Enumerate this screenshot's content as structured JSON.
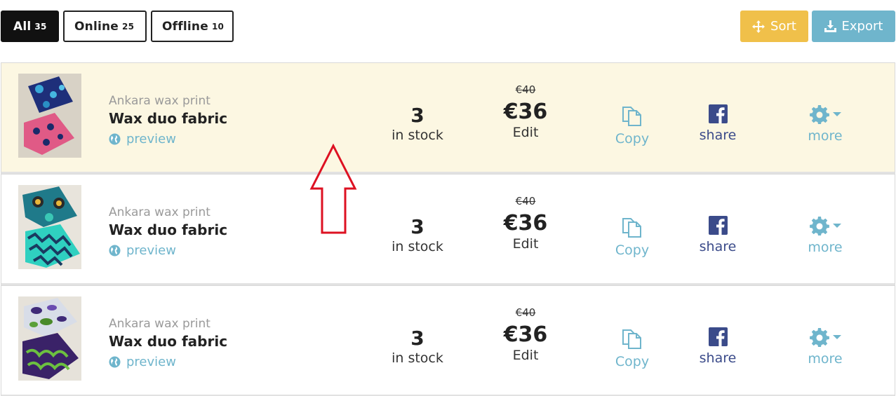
{
  "filters": [
    {
      "label": "All",
      "count": "35",
      "active": true
    },
    {
      "label": "Online",
      "count": "25",
      "active": false
    },
    {
      "label": "Offline",
      "count": "10",
      "active": false
    }
  ],
  "toolbar": {
    "sort_label": "Sort",
    "export_label": "Export"
  },
  "colors": {
    "sort": "#f0c04a",
    "export": "#6fb5cc",
    "highlight": "#fcf7e2",
    "link": "#6fb5cc",
    "facebook": "#3b4b8a",
    "annotation_arrow": "#dd1122"
  },
  "products": [
    {
      "category": "Ankara wax print",
      "title": "Wax duo fabric",
      "preview": "preview",
      "stock": "3",
      "stock_label": "in stock",
      "old_price": "€40",
      "price": "€36",
      "edit": "Edit",
      "copy": "Copy",
      "share": "share",
      "more": "more"
    },
    {
      "category": "Ankara wax print",
      "title": "Wax duo fabric",
      "preview": "preview",
      "stock": "3",
      "stock_label": "in stock",
      "old_price": "€40",
      "price": "€36",
      "edit": "Edit",
      "copy": "Copy",
      "share": "share",
      "more": "more"
    },
    {
      "category": "Ankara wax print",
      "title": "Wax duo fabric",
      "preview": "preview",
      "stock": "3",
      "stock_label": "in stock",
      "old_price": "€40",
      "price": "€36",
      "edit": "Edit",
      "copy": "Copy",
      "share": "share",
      "more": "more"
    }
  ]
}
